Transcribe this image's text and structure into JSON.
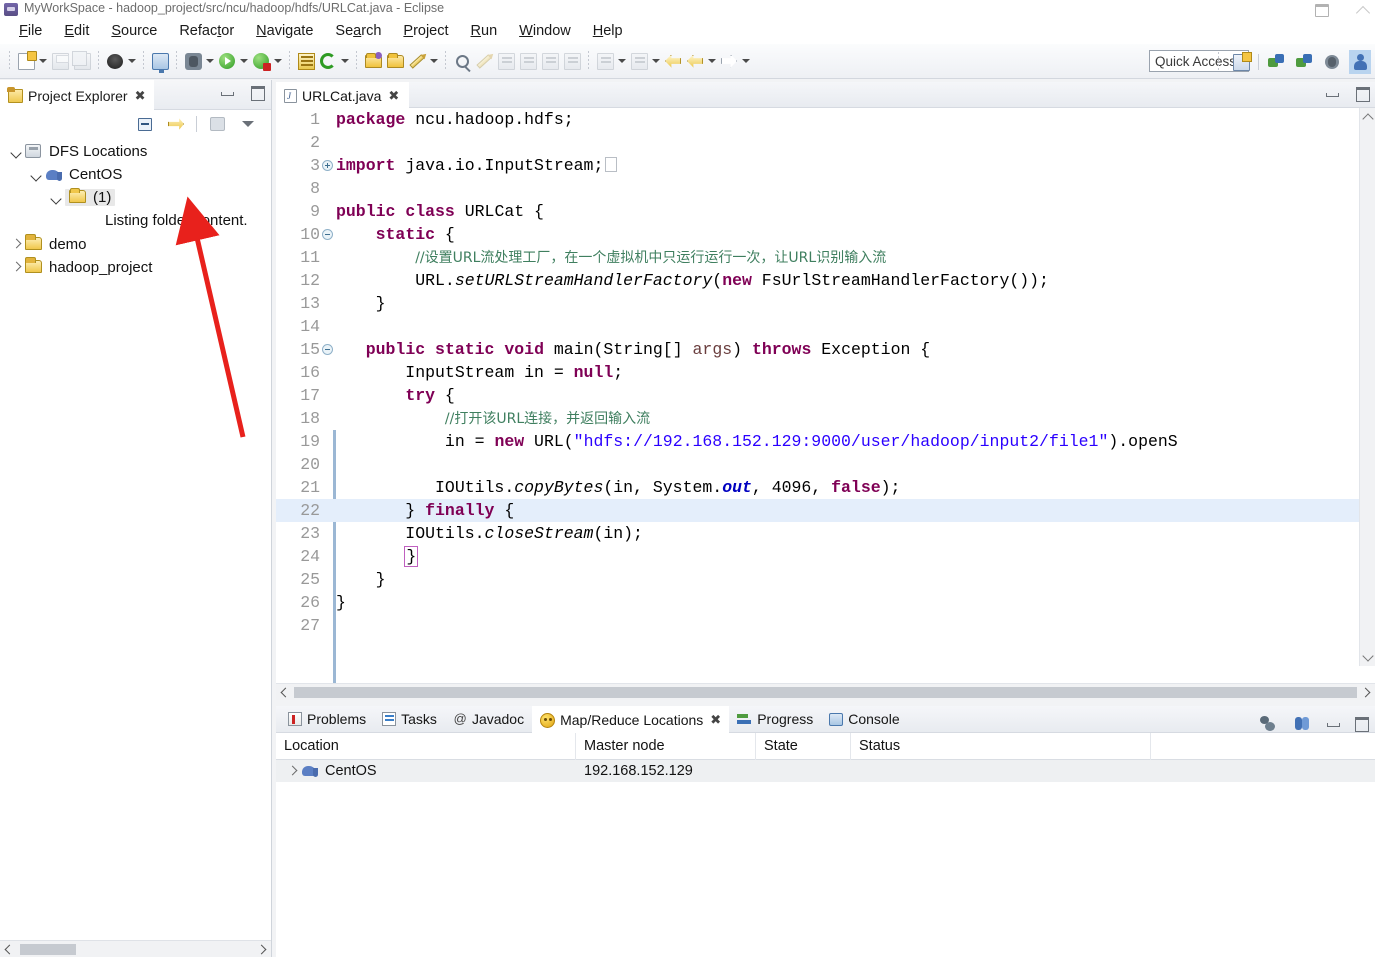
{
  "window": {
    "title": "MyWorkSpace - hadoop_project/src/ncu/hadoop/hdfs/URLCat.java - Eclipse",
    "icon": "eclipse-icon",
    "controls": [
      "restore-button",
      "minimize-button"
    ]
  },
  "menubar": {
    "items": [
      {
        "label": "File",
        "mnemonic": "F"
      },
      {
        "label": "Edit",
        "mnemonic": "E"
      },
      {
        "label": "Source",
        "mnemonic": "S"
      },
      {
        "label": "Refactor",
        "mnemonic": "t"
      },
      {
        "label": "Navigate",
        "mnemonic": "N"
      },
      {
        "label": "Search",
        "mnemonic": "a"
      },
      {
        "label": "Project",
        "mnemonic": "P"
      },
      {
        "label": "Run",
        "mnemonic": "R"
      },
      {
        "label": "Window",
        "mnemonic": "W"
      },
      {
        "label": "Help",
        "mnemonic": "H"
      }
    ]
  },
  "toolbar": {
    "quick_access_placeholder": "Quick Access",
    "buttons": [
      "new-wizard-button",
      "save-button",
      "save-all-button",
      "print-button",
      "open-console-button",
      "debug-button",
      "run-button",
      "run-external-tools-button",
      "new-java-project-button",
      "refresh-button",
      "open-type-button",
      "open-task-button",
      "new-annotation-button",
      "search-button",
      "next-annotation-button",
      "previous-annotation-button",
      "back-button",
      "forward-button",
      "new-perspective-button",
      "open-mapreduce-perspective-button",
      "debug-perspective-button",
      "java-perspective-button"
    ]
  },
  "explorer": {
    "tab_title": "Project Explorer",
    "toolbar_icons": [
      "collapse-all-icon",
      "link-with-editor-icon",
      "focus-on-active-task-icon",
      "view-menu-icon"
    ],
    "tree": [
      {
        "label": "DFS Locations",
        "icon": "dfs-locations-icon",
        "indent": 0,
        "twisty": "down",
        "selected": false
      },
      {
        "label": "CentOS",
        "icon": "hadoop-elephant-icon",
        "indent": 1,
        "twisty": "down",
        "selected": false
      },
      {
        "label": "(1)",
        "icon": "folder-open-icon",
        "indent": 2,
        "twisty": "down",
        "selected": true
      },
      {
        "label": "demo",
        "icon": "project-folder-icon",
        "indent": 0,
        "twisty": "right",
        "selected": false
      },
      {
        "label": "hadoop_project",
        "icon": "project-folder-icon",
        "indent": 0,
        "twisty": "right",
        "selected": false
      }
    ],
    "listing_message": "Listing folder content."
  },
  "editor": {
    "tab_label": "URLCat.java",
    "tab_icon": "java-file-icon",
    "highlighted_line": 22,
    "lines": [
      {
        "n": "1",
        "fold": "",
        "html": "<span class=\"kw\">package</span> ncu.hadoop.hdfs;"
      },
      {
        "n": "2",
        "fold": "",
        "html": ""
      },
      {
        "n": "3",
        "fold": "plus",
        "html": "<span class=\"kw\">import</span> java.io.InputStream;<span class=\"foldbox\"></span>"
      },
      {
        "n": "8",
        "fold": "",
        "html": ""
      },
      {
        "n": "9",
        "fold": "",
        "html": "<span class=\"kw\">public</span> <span class=\"kw\">class</span> URLCat {"
      },
      {
        "n": "10",
        "fold": "minus",
        "html": "    <span class=\"kw\">static</span> {"
      },
      {
        "n": "11",
        "fold": "",
        "html": "        <span class=\"cmt-cjk\">//设置URL流处理工厂，在一个虚拟机中只运行运行一次，让URL识别输入流</span>"
      },
      {
        "n": "12",
        "fold": "",
        "html": "        URL.<span class=\"stat\">setURLStreamHandlerFactory</span>(<span class=\"kw\">new</span> FsUrlStreamHandlerFactory());"
      },
      {
        "n": "13",
        "fold": "",
        "html": "    }"
      },
      {
        "n": "14",
        "fold": "",
        "html": ""
      },
      {
        "n": "15",
        "fold": "minus",
        "html": "   <span class=\"kw\">public</span> <span class=\"kw\">static</span> <span class=\"kw\">void</span> main(String[] <span class=\"param\">args</span>) <span class=\"kw\">throws</span> Exception {"
      },
      {
        "n": "16",
        "fold": "",
        "html": "       InputStream in = <span class=\"kw\">null</span>;"
      },
      {
        "n": "17",
        "fold": "",
        "html": "       <span class=\"kw\">try</span> {"
      },
      {
        "n": "18",
        "fold": "",
        "html": "           <span class=\"cmt-cjk\">//打开该URL连接，并返回输入流</span>"
      },
      {
        "n": "19",
        "fold": "",
        "html": "           in = <span class=\"kw\">new</span> URL(<span class=\"str\">\"hdfs://192.168.152.129:9000/user/hadoop/input2/file1\"</span>).openS"
      },
      {
        "n": "20",
        "fold": "",
        "html": ""
      },
      {
        "n": "21",
        "fold": "",
        "html": "          IOUtils.<span class=\"stat\">copyBytes</span>(in, System.<span class=\"fld\">out</span>, 4096, <span class=\"kw\">false</span>);"
      },
      {
        "n": "22",
        "fold": "",
        "html": "       } <span class=\"kw\">finally</span> {"
      },
      {
        "n": "23",
        "fold": "",
        "html": "       IOUtils.<span class=\"stat\">closeStream</span>(in);"
      },
      {
        "n": "24",
        "fold": "",
        "html": "       <span class=\"brbox\">}</span>"
      },
      {
        "n": "25",
        "fold": "",
        "html": "    }"
      },
      {
        "n": "26",
        "fold": "",
        "html": "}"
      },
      {
        "n": "27",
        "fold": "",
        "html": ""
      }
    ]
  },
  "bottom_panel": {
    "tabs": [
      {
        "label": "Problems",
        "icon": "problems-icon",
        "active": false
      },
      {
        "label": "Tasks",
        "icon": "tasks-icon",
        "active": false
      },
      {
        "label": "Javadoc",
        "icon": "javadoc-icon",
        "active": false
      },
      {
        "label": "Map/Reduce Locations",
        "icon": "map-reduce-locations-icon",
        "active": true
      },
      {
        "label": "Progress",
        "icon": "progress-icon",
        "active": false
      },
      {
        "label": "Console",
        "icon": "console-icon",
        "active": false
      }
    ],
    "toolbar_icons": [
      "new-hadoop-location-icon",
      "edit-hadoop-location-icon"
    ],
    "table": {
      "columns": [
        "Location",
        "Master node",
        "State",
        "Status"
      ],
      "rows": [
        {
          "location": "CentOS",
          "master_node": "192.168.152.129",
          "state": "",
          "status": "",
          "icon": "hadoop-elephant-icon"
        }
      ]
    }
  },
  "annotation": {
    "type": "red-arrow",
    "color": "#e8211c",
    "points_to": "Listing folder content."
  }
}
